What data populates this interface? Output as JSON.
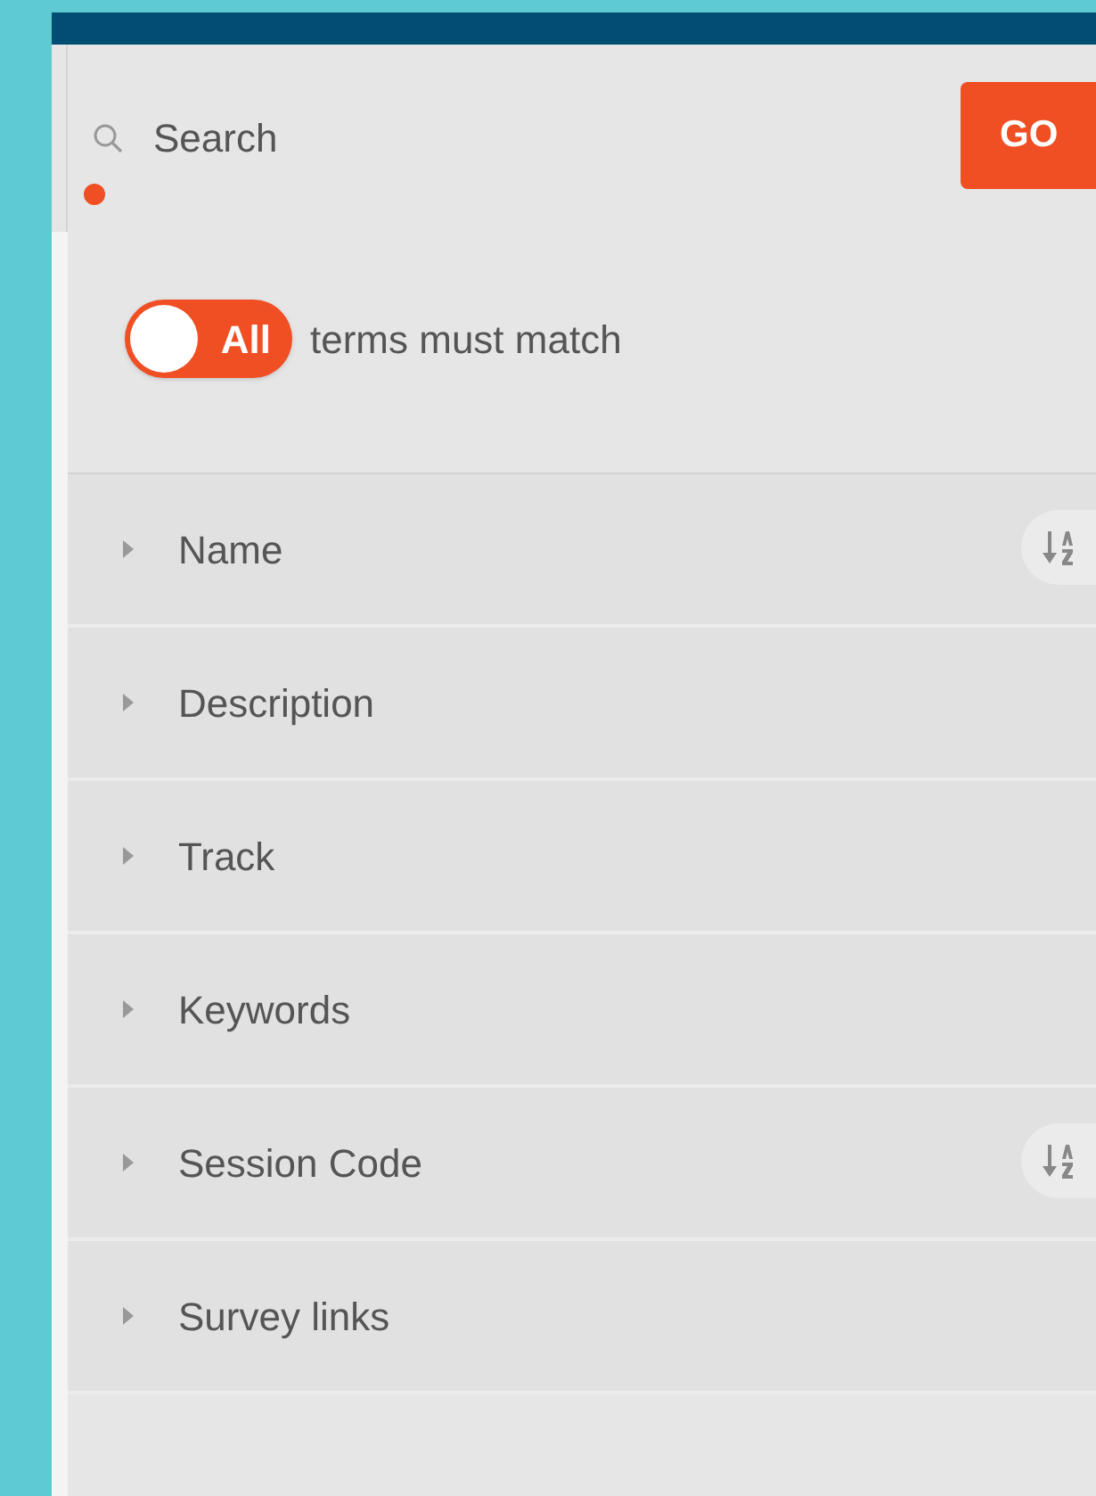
{
  "search": {
    "placeholder": "Search",
    "button": "GO"
  },
  "match_toggle": {
    "on": true,
    "label": "All",
    "text": "terms must match"
  },
  "fields": [
    {
      "label": "Name",
      "expanded": false,
      "sortable": true
    },
    {
      "label": "Description",
      "expanded": false,
      "sortable": false
    },
    {
      "label": "Track",
      "expanded": false,
      "sortable": false
    },
    {
      "label": "Keywords",
      "expanded": false,
      "sortable": false
    },
    {
      "label": "Session Code",
      "expanded": false,
      "sortable": true
    },
    {
      "label": "Survey links",
      "expanded": false,
      "sortable": false
    }
  ]
}
